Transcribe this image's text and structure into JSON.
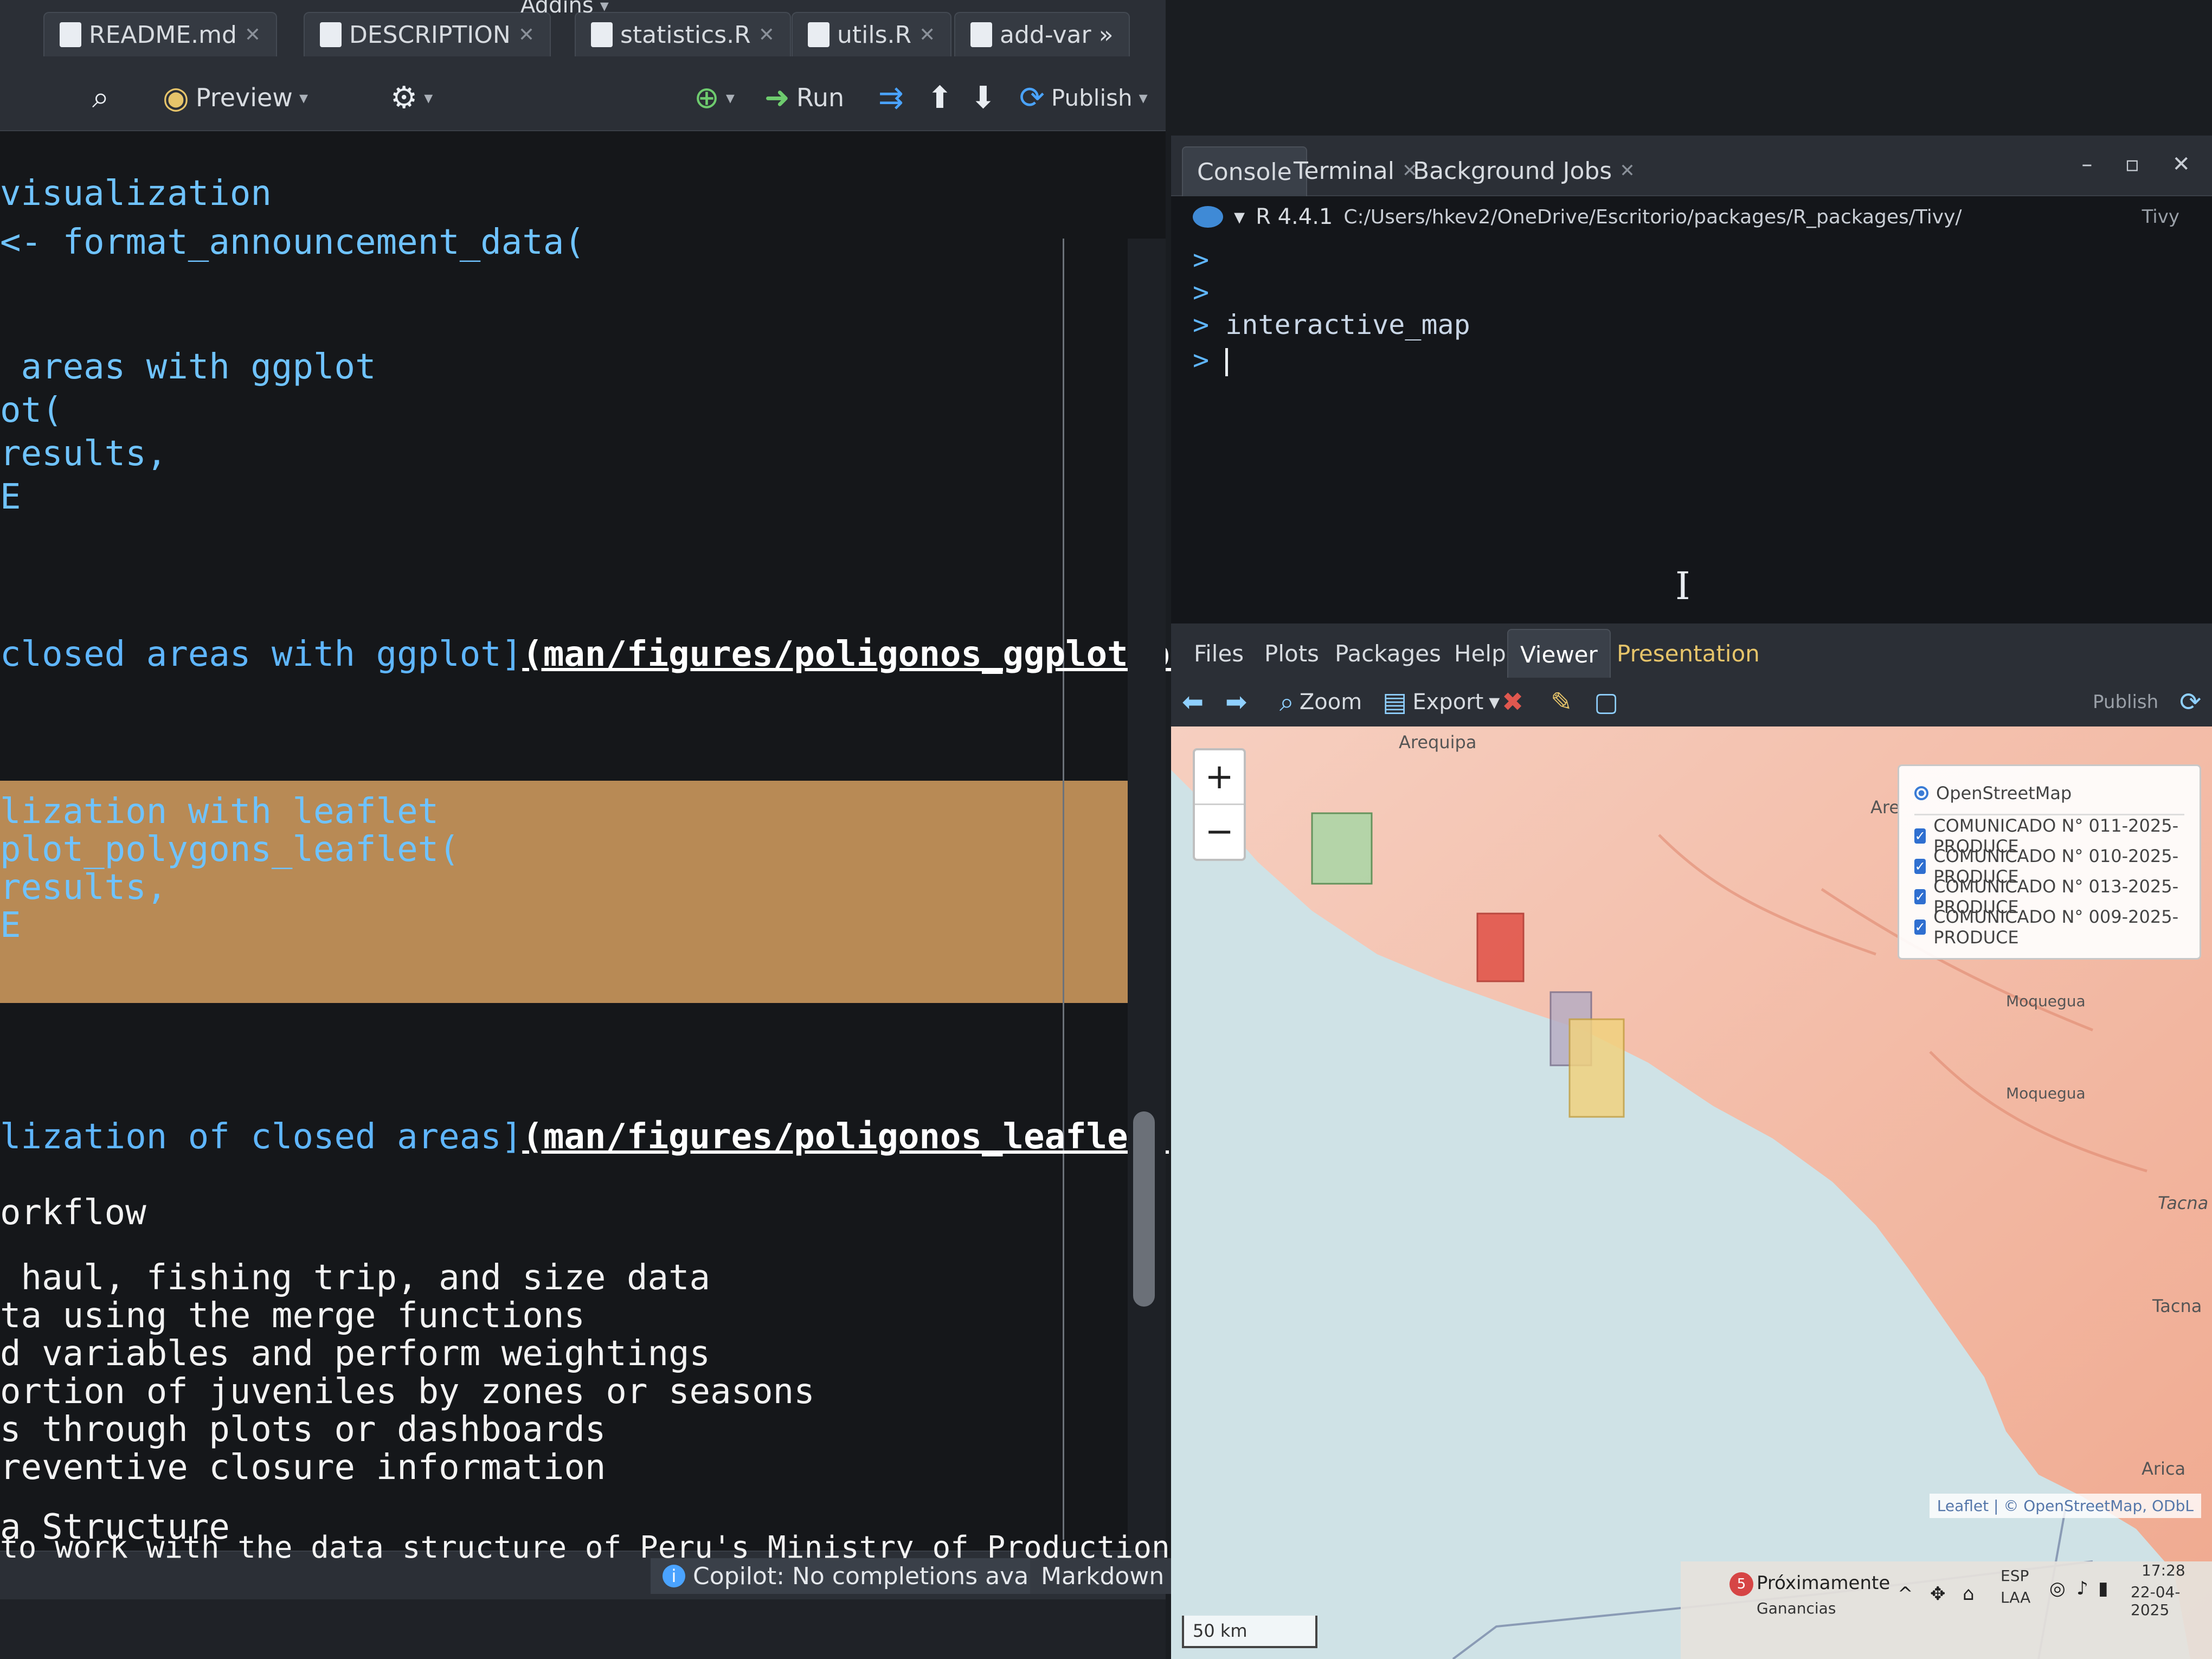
{
  "editor": {
    "addins_label": "Addins",
    "tabs": [
      {
        "label": "README.md"
      },
      {
        "label": "DESCRIPTION"
      },
      {
        "label": "statistics.R"
      },
      {
        "label": "utils.R"
      },
      {
        "label": "add-var"
      }
    ],
    "toolbar": {
      "preview_label": "Preview",
      "run_label": "Run",
      "publish_label": "Publish"
    },
    "code_lines": [
      "visualization",
      "<- format_announcement_data(",
      " areas with ggplot",
      "ot(",
      "results,",
      "E",
      "closed areas with ggplot]",
      "(man/figures/poligonos_ggplot.png)",
      "lization with leaflet",
      "plot_polygons_leaflet(",
      "results,",
      "E",
      "lization of closed areas]",
      "(man/figures/poligonos_leaflet.png)",
      "orkflow",
      " haul, fishing trip, and size data",
      "ta using the merge functions",
      "d variables and perform weightings",
      "ortion of juveniles by zones or seasons",
      "s through plots or dashboards",
      "reventive closure information",
      "a Structure",
      "to work with the data structure of Peru's Ministry of Production."
    ],
    "status": {
      "copilot": "Copilot: No completions available.",
      "language": "Markdown"
    }
  },
  "console": {
    "tabs": [
      {
        "label": "Console"
      },
      {
        "label": "Terminal"
      },
      {
        "label": "Background Jobs"
      }
    ],
    "r_version": "R 4.4.1",
    "path": "C:/Users/hkev2/OneDrive/Escritorio/packages/R_packages/Tivy/",
    "project": "Tivy",
    "prompt": ">",
    "command": "interactive_map"
  },
  "viewer": {
    "tabs": [
      {
        "label": "Files"
      },
      {
        "label": "Plots"
      },
      {
        "label": "Packages"
      },
      {
        "label": "Help"
      },
      {
        "label": "Viewer"
      },
      {
        "label": "Presentation"
      }
    ],
    "toolbar": {
      "zoom_label": "Zoom",
      "export_label": "Export",
      "publish_label": "Publish"
    },
    "map": {
      "zoom_in": "+",
      "zoom_out": "−",
      "base_layer": "OpenStreetMap",
      "overlays": [
        "COMUNICADO N° 011-2025-PRODUCE",
        "COMUNICADO N° 010-2025-PRODUCE",
        "COMUNICADO N° 013-2025-PRODUCE",
        "COMUNICADO N° 009-2025-PRODUCE"
      ],
      "cities": [
        "Arequipa",
        "Are",
        "Moquegua",
        "Moquegua",
        "Tacna",
        "Tacna",
        "Arica"
      ],
      "attribution": "Leaflet | © OpenStreetMap, ODbL",
      "scale": "50 km",
      "polygon_colors": [
        "#a9d6a6",
        "#e2574c",
        "#b8aec4",
        "#f1d27f"
      ]
    }
  },
  "taskbar": {
    "notification_title": "Próximamente",
    "notification_sub": "Ganancias",
    "badge": "5",
    "lang_top": "ESP",
    "lang_bottom": "LAA",
    "time": "17:28",
    "date": "22-04-2025"
  }
}
